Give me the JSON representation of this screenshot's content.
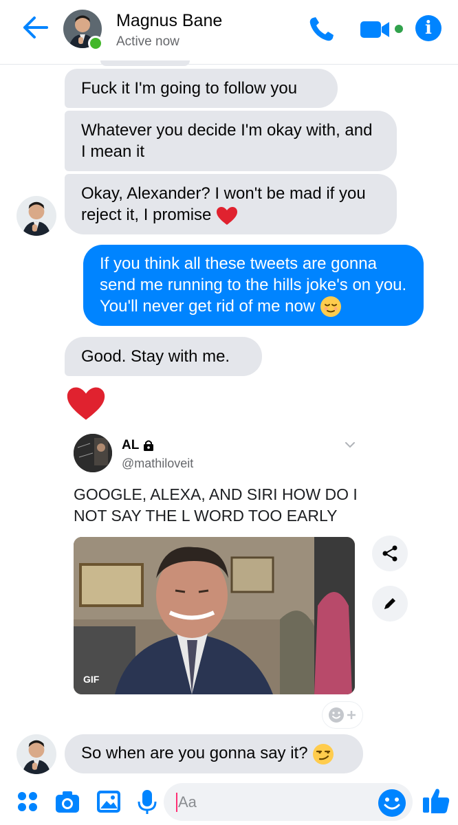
{
  "header": {
    "contact_name": "Magnus Bane",
    "status": "Active now",
    "accent": "#0084ff"
  },
  "messages": [
    {
      "from": "them",
      "text": "Fuck it I'm going to follow you"
    },
    {
      "from": "them",
      "text": "Whatever you decide I'm okay with, and I mean it"
    },
    {
      "from": "them",
      "text": "Okay, Alexander? I won't be mad if you reject it, I promise",
      "emoji": "red-heart"
    },
    {
      "from": "me",
      "text": "If you think all these tweets are gonna send me running to the hills joke's on you. You'll never get rid of me now",
      "emoji": "relieved-face"
    },
    {
      "from": "them",
      "text": "Good. Stay with me."
    },
    {
      "from": "them",
      "emoji_only": "red-heart"
    },
    {
      "from": "them",
      "text": "So when are you gonna say it?",
      "emoji": "smirking-face"
    }
  ],
  "shared_tweet": {
    "name": "AL",
    "handle": "@mathiloveit",
    "text": "GOOGLE, ALEXA, AND SIRI HOW DO I NOT SAY THE L WORD TOO EARLY",
    "gif_label": "GIF"
  },
  "composer": {
    "placeholder": "Aa"
  }
}
